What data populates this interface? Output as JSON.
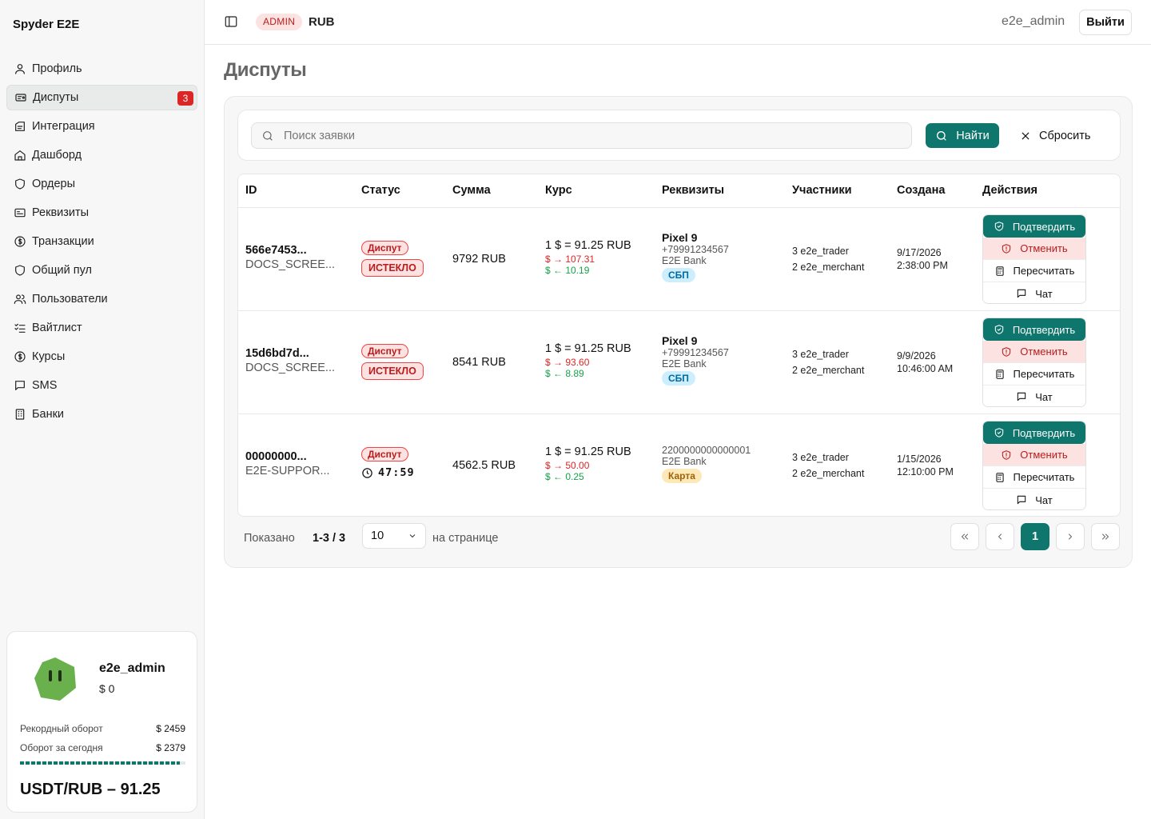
{
  "app": {
    "brand": "Spyder E2E"
  },
  "sidebar": {
    "items": [
      {
        "label": "Профиль",
        "icon": "user-icon"
      },
      {
        "label": "Диспуты",
        "icon": "ticket-icon",
        "badge": "3",
        "active": true
      },
      {
        "label": "Интеграция",
        "icon": "plug-icon"
      },
      {
        "label": "Дашборд",
        "icon": "home-icon"
      },
      {
        "label": "Ордеры",
        "icon": "shield-icon"
      },
      {
        "label": "Реквизиты",
        "icon": "card-icon"
      },
      {
        "label": "Транзакции",
        "icon": "dollar-icon"
      },
      {
        "label": "Общий пул",
        "icon": "shield-icon"
      },
      {
        "label": "Пользователи",
        "icon": "users-icon"
      },
      {
        "label": "Вайтлист",
        "icon": "list-check-icon"
      },
      {
        "label": "Курсы",
        "icon": "dollar-icon"
      },
      {
        "label": "SMS",
        "icon": "message-icon"
      },
      {
        "label": "Банки",
        "icon": "building-icon"
      }
    ],
    "user_card": {
      "name": "e2e_admin",
      "balance": "$ 0",
      "record_label": "Рекордный оборот",
      "record_value": "$ 2459",
      "today_label": "Оборот за сегодня",
      "today_value": "$ 2379",
      "progress_fraction": 0.967,
      "rate": "USDT/RUB – 91.25"
    }
  },
  "header": {
    "role_badge": "ADMIN",
    "currency": "RUB",
    "username": "e2e_admin",
    "logout_label": "Выйти"
  },
  "page": {
    "title": "Диспуты"
  },
  "search": {
    "placeholder": "Поиск заявки",
    "find_label": "Найти",
    "reset_label": "Сбросить"
  },
  "table": {
    "columns": [
      "ID",
      "Статус",
      "Сумма",
      "Курс",
      "Реквизиты",
      "Участники",
      "Создана",
      "Действия"
    ],
    "actions": {
      "confirm": "Подтвердить",
      "cancel": "Отменить",
      "recalc": "Пересчитать",
      "chat": "Чат"
    },
    "rows": [
      {
        "id": "566e7453...",
        "sub": "DOCS_SCREE...",
        "status": "Диспут",
        "status2": "ИСТЕКЛО",
        "amount": "9792 RUB",
        "rate": "1 $ = 91.25 RUB",
        "rate_out": "$ → 107.31",
        "rate_in": "$ ← 10.19",
        "req_name": "Pixel 9",
        "req_phone": "+79991234567",
        "req_bank": "E2E Bank",
        "req_method": "СБП",
        "participant1": "3 e2e_trader",
        "participant2": "2 e2e_merchant",
        "created_date": "9/17/2026",
        "created_time": "2:38:00 PM"
      },
      {
        "id": "15d6bd7d...",
        "sub": "DOCS_SCREE...",
        "status": "Диспут",
        "status2": "ИСТЕКЛО",
        "amount": "8541 RUB",
        "rate": "1 $ = 91.25 RUB",
        "rate_out": "$ → 93.60",
        "rate_in": "$ ← 8.89",
        "req_name": "Pixel 9",
        "req_phone": "+79991234567",
        "req_bank": "E2E Bank",
        "req_method": "СБП",
        "participant1": "3 e2e_trader",
        "participant2": "2 e2e_merchant",
        "created_date": "9/9/2026",
        "created_time": "10:46:00 AM"
      },
      {
        "id": "00000000...",
        "sub": "E2E-SUPPOR...",
        "status": "Диспут",
        "timer": "47:59",
        "amount": "4562.5 RUB",
        "rate": "1 $ = 91.25 RUB",
        "rate_out": "$ → 50.00",
        "rate_in": "$ ← 0.25",
        "req_card": "2200000000000001",
        "req_bank": "E2E Bank",
        "req_method": "Карта",
        "participant1": "3 e2e_trader",
        "participant2": "2 e2e_merchant",
        "created_date": "1/15/2026",
        "created_time": "12:10:00 PM"
      }
    ]
  },
  "pagination": {
    "shown_label": "Показано",
    "shown_value": "1-3 / 3",
    "per_page_value": "10",
    "per_page_label": "на странице",
    "current_page": "1"
  },
  "colors": {
    "accent": "#0f766e",
    "danger": "#dc2626",
    "success": "#16a34a"
  }
}
